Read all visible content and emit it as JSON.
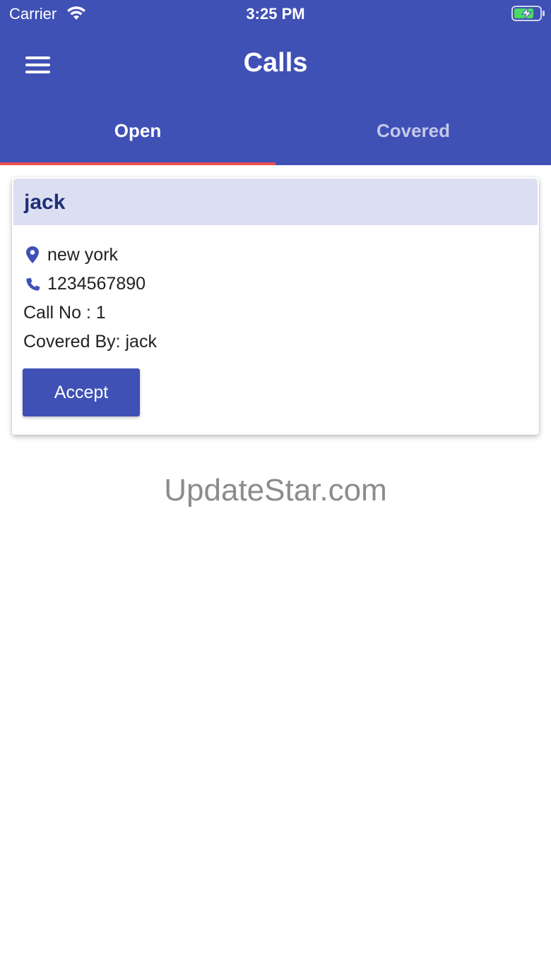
{
  "status_bar": {
    "carrier": "Carrier",
    "time": "3:25 PM",
    "icons": [
      "wifi-icon",
      "battery-charging-icon"
    ]
  },
  "header": {
    "title": "Calls",
    "menu_icon": "hamburger-menu-icon"
  },
  "tabs": [
    {
      "label": "Open",
      "active": true
    },
    {
      "label": "Covered",
      "active": false
    }
  ],
  "call_card": {
    "name": "jack",
    "location": "new york",
    "location_icon": "map-marker-icon",
    "phone": "1234567890",
    "phone_icon": "phone-icon",
    "call_no": "Call No : 1",
    "covered_by": "Covered By: jack",
    "accept_label": "Accept"
  },
  "watermark": "UpdateStar.com",
  "colors": {
    "primary": "#3f51b5",
    "tab_indicator": "#e8504f",
    "card_header_bg": "#dcdff1",
    "card_name": "#1f2f7a"
  }
}
